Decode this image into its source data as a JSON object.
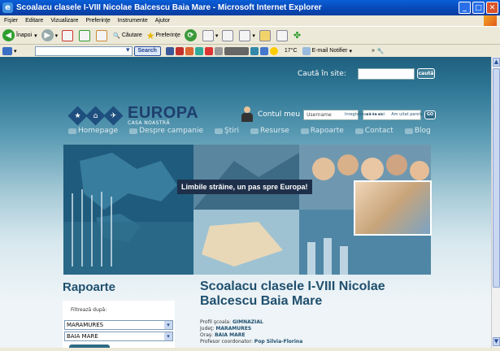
{
  "window": {
    "title": "Scoalacu clasele I-VIII Nicolae Balcescu Baia Mare - Microsoft Internet Explorer"
  },
  "menubar": {
    "items": [
      "Fişier",
      "Editare",
      "Vizualizare",
      "Preferinţe",
      "Instrumente",
      "Ajutor"
    ]
  },
  "toolbar": {
    "back_label": "Înapoi",
    "search_label": "Căutare",
    "favorites_label": "Preferinţe"
  },
  "toolbar2": {
    "search_button": "Search",
    "weather": "17°C",
    "email_notifier": "E-mail Notifier"
  },
  "site": {
    "search_label": "Caută în site:",
    "search_button": "caută",
    "logo_word": "EUROPA",
    "logo_sub": "CASA NOASTRĂ",
    "account_label": "Contul meu",
    "username_placeholder": "Username",
    "password_value": "••••••",
    "go_button": "GO",
    "register_link": "Inregistrează-te aici",
    "forgot_link": "Am uitat parola",
    "nav": [
      "Homepage",
      "Despre campanie",
      "Ştiri",
      "Resurse",
      "Rapoarte",
      "Contact",
      "Blog"
    ],
    "hero_caption": "Limbile străine, un pas spre Europa!",
    "sidebar_title": "Rapoarte",
    "filter_label": "Filtrează după:",
    "filter_county": "MARAMURES",
    "filter_city": "BAIA MARE",
    "school_title": "Scoalacu clasele I-VIII Nicolae Balcescu Baia Mare",
    "info": [
      {
        "label": "Profil şcoala:",
        "value": "GIMNAZIAL"
      },
      {
        "label": "Judeţ:",
        "value": "MARAMURES"
      },
      {
        "label": "Oraş:",
        "value": "BAIA MARE"
      },
      {
        "label": "Profesor coordonator:",
        "value": "Pop Silvia-Florina"
      }
    ]
  }
}
